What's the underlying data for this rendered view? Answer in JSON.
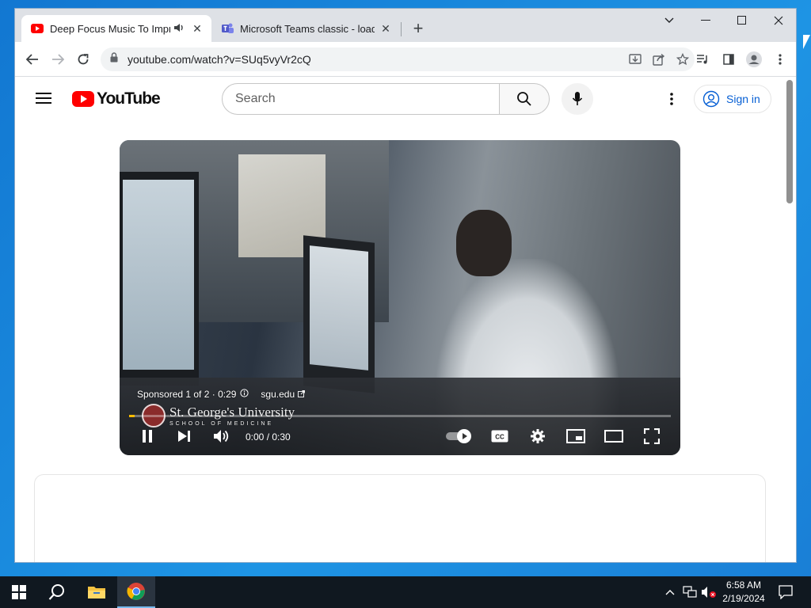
{
  "browser": {
    "tabs": [
      {
        "title": "Deep Focus Music To Improv",
        "favicon": "youtube-icon",
        "audio": "speaker-icon",
        "active": true
      },
      {
        "title": "Microsoft Teams classic - loading",
        "favicon": "teams-icon",
        "active": false
      }
    ],
    "url": "youtube.com/watch?v=SUq5vyVr2cQ",
    "icons": {
      "back": "arrow-left-icon",
      "forward": "arrow-right-icon",
      "reload": "reload-icon",
      "lock": "lock-icon",
      "install": "install-app-icon",
      "share": "share-icon",
      "bookmark": "star-icon",
      "media": "media-control-icon",
      "sidepanel": "side-panel-icon",
      "profile": "profile-icon",
      "menu": "kebab-menu-icon"
    }
  },
  "youtube": {
    "logo_text": "YouTube",
    "search_placeholder": "Search",
    "signin_label": "Sign in",
    "brand_color": "#ff0000",
    "link_color": "#065fd4"
  },
  "player": {
    "ad_label": "Sponsored 1 of 2 · 0:29",
    "ad_link": "sgu.edu",
    "sponsor_name": "St. George's University",
    "sponsor_sub": "SCHOOL OF MEDICINE",
    "time": "0:00 / 0:30",
    "progress_fraction": 0.01,
    "ad_progress_color": "#fcbc00",
    "cc_label": "CC"
  },
  "taskbar": {
    "time": "6:58 AM",
    "date": "2/19/2024"
  }
}
